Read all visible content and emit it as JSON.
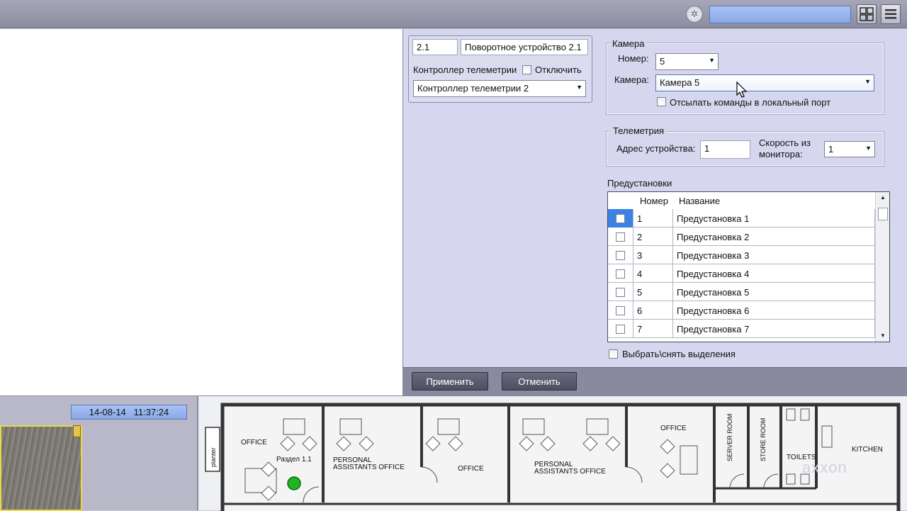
{
  "toolbar": {
    "gear_icon": "gear-icon",
    "search_value": "",
    "layout_icon": "layout-grid-icon",
    "menu_icon": "menu-icon"
  },
  "controller": {
    "id": "2.1",
    "name": "Поворотное устройство 2.1",
    "telemetry_label": "Контроллер телеметрии",
    "disable_label": "Отключить",
    "telemetry_select": "Контроллер телеметрии 2"
  },
  "camera_group": {
    "title": "Камера",
    "number_label": "Номер:",
    "number_value": "5",
    "camera_label": "Камера:",
    "camera_value": "Камера 5",
    "local_port_label": "Отсылать команды в локальный порт"
  },
  "telemetry_group": {
    "title": "Телеметрия",
    "address_label": "Адрес устройства:",
    "address_value": "1",
    "speed_label_line1": "Скорость из",
    "speed_label_line2": "монитора:",
    "speed_value": "1"
  },
  "presets": {
    "title": "Предустановки",
    "columns": [
      "Номер",
      "Название"
    ],
    "rows": [
      {
        "num": "1",
        "name": "Предустановка 1"
      },
      {
        "num": "2",
        "name": "Предустановка 2"
      },
      {
        "num": "3",
        "name": "Предустановка 3"
      },
      {
        "num": "4",
        "name": "Предустановка 4"
      },
      {
        "num": "5",
        "name": "Предустановка 5"
      },
      {
        "num": "6",
        "name": "Предустановка 6"
      },
      {
        "num": "7",
        "name": "Предустановка 7"
      }
    ],
    "select_all_label": "Выбрать\\снять выделения"
  },
  "buttons": {
    "apply": "Применить",
    "cancel": "Отменить"
  },
  "status": {
    "date": "14-08-14",
    "time": "11:37:24"
  },
  "floor_plan": {
    "rooms": [
      "OFFICE",
      "PERSONAL ASSISTANTS OFFICE",
      "OFFICE",
      "PERSONAL ASSISTANTS OFFICE",
      "OFFICE",
      "SERVER ROOM",
      "STORE ROOM",
      "TOILETS",
      "KITCHEN"
    ],
    "planter_label": "planter",
    "zone_label": "Раздел 1.1",
    "watermark": "axxon"
  },
  "colors": {
    "accent_blue": "#9ab4ee",
    "panel_bg": "#d6d6ee",
    "zone_green": "#22b422"
  }
}
